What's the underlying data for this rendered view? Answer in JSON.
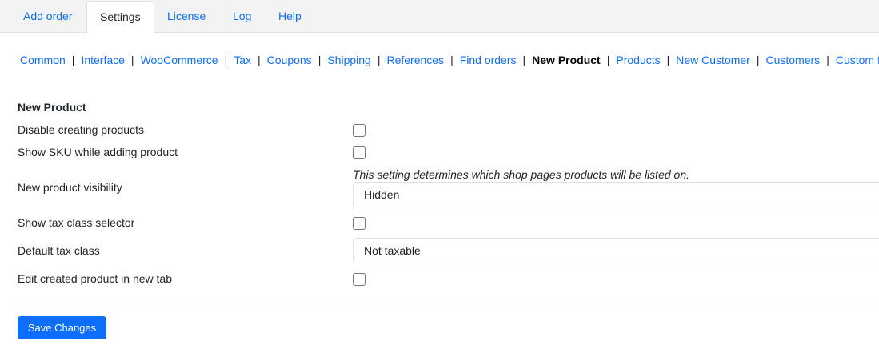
{
  "tabs": [
    {
      "label": "Add order"
    },
    {
      "label": "Settings",
      "active": true
    },
    {
      "label": "License"
    },
    {
      "label": "Log"
    },
    {
      "label": "Help"
    }
  ],
  "subnav": [
    {
      "label": "Common"
    },
    {
      "label": "Interface"
    },
    {
      "label": "WooCommerce"
    },
    {
      "label": "Tax"
    },
    {
      "label": "Coupons"
    },
    {
      "label": "Shipping"
    },
    {
      "label": "References"
    },
    {
      "label": "Find orders"
    },
    {
      "label": "New Product",
      "current": true
    },
    {
      "label": "Products"
    },
    {
      "label": "New Customer"
    },
    {
      "label": "Customers"
    },
    {
      "label": "Custom fields"
    }
  ],
  "separator": "|",
  "form": {
    "title": "New Product",
    "disable_creating": {
      "label": "Disable creating products",
      "checked": false
    },
    "show_sku": {
      "label": "Show SKU while adding product",
      "checked": false
    },
    "visibility": {
      "label": "New product visibility",
      "hint": "This setting determines which shop pages products will be listed on.",
      "value": "Hidden"
    },
    "show_tax_selector": {
      "label": "Show tax class selector",
      "checked": false
    },
    "default_tax": {
      "label": "Default tax class",
      "value": "Not taxable"
    },
    "edit_new_tab": {
      "label": "Edit created product in new tab",
      "checked": false
    }
  },
  "save_label": "Save Changes",
  "colors": {
    "accent": "#0d6efd",
    "text": "#212529",
    "topbar": "#f3f3f3"
  }
}
